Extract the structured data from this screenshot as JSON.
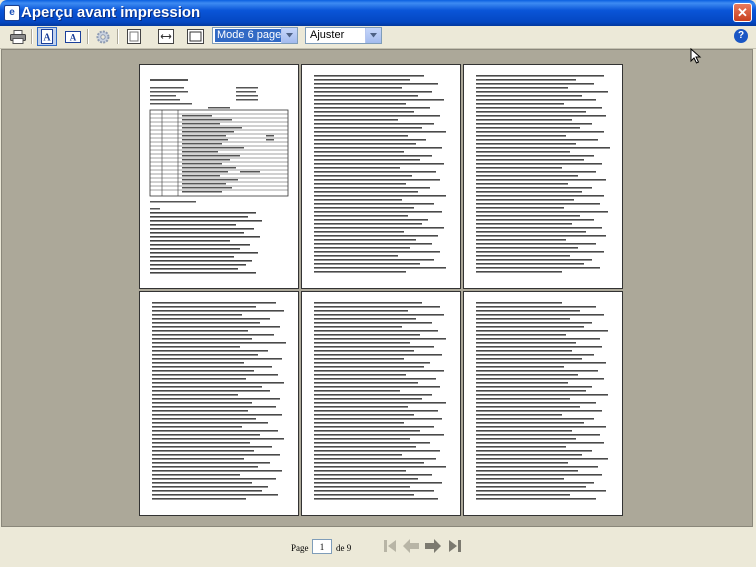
{
  "window": {
    "title": "Aperçu avant impression",
    "icon_letter": "e",
    "close_glyph": "✕"
  },
  "toolbar": {
    "view_mode_value": "Mode 6 pages",
    "zoom_value": "Ajuster",
    "help_glyph": "?"
  },
  "pager": {
    "page_label": "Page",
    "current_page": "1",
    "of_label": "de 9"
  },
  "colors": {
    "titlebar": "#0a55d8",
    "preview_background": "#aca899",
    "selection": "#316ac5"
  }
}
